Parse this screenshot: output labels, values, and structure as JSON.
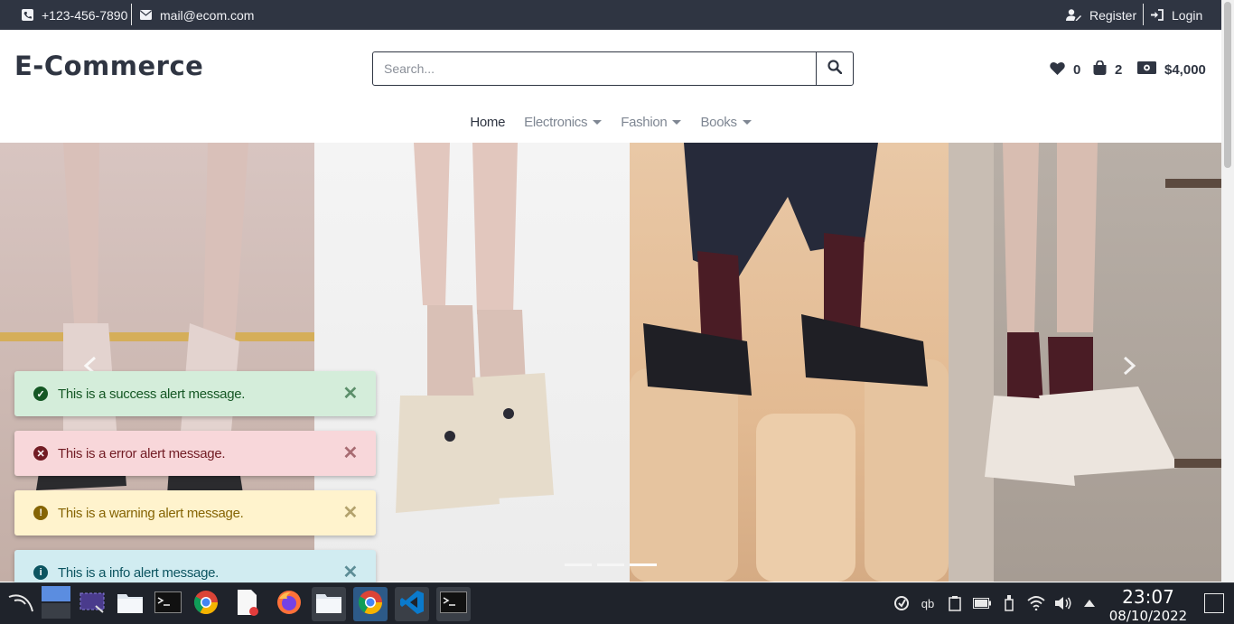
{
  "topbar": {
    "phone": "+123-456-7890",
    "email": "mail@ecom.com",
    "register_label": "Register",
    "login_label": "Login"
  },
  "header": {
    "logo": "E-Commerce",
    "search_placeholder": "Search...",
    "wishlist_count": "0",
    "cart_count": "2",
    "balance": "$4,000"
  },
  "nav": {
    "items": [
      {
        "label": "Home",
        "active": true
      },
      {
        "label": "Electronics",
        "dropdown": true
      },
      {
        "label": "Fashion",
        "dropdown": true
      },
      {
        "label": "Books",
        "dropdown": true
      }
    ]
  },
  "carousel": {
    "indicator_count": 3,
    "active_indicator": 3
  },
  "alerts": [
    {
      "type": "success",
      "text": "This is a success alert message."
    },
    {
      "type": "error",
      "text": "This is a error alert message."
    },
    {
      "type": "warning",
      "text": "This is a warning alert message."
    },
    {
      "type": "info",
      "text": "This is a info alert message."
    }
  ],
  "taskbar": {
    "time": "23:07",
    "date": "08/10/2022",
    "apps": [
      "kali-menu-icon",
      "workspace-icon",
      "screenshot-icon",
      "file-manager-icon",
      "terminal-icon",
      "chrome-icon",
      "text-editor-icon",
      "firefox-icon",
      "file-manager-icon",
      "chrome-icon",
      "vscode-icon",
      "terminal-icon"
    ]
  },
  "colors": {
    "topbar_bg": "#2f3542",
    "primary_text": "#2f3542",
    "nav_muted": "#7f8793"
  }
}
